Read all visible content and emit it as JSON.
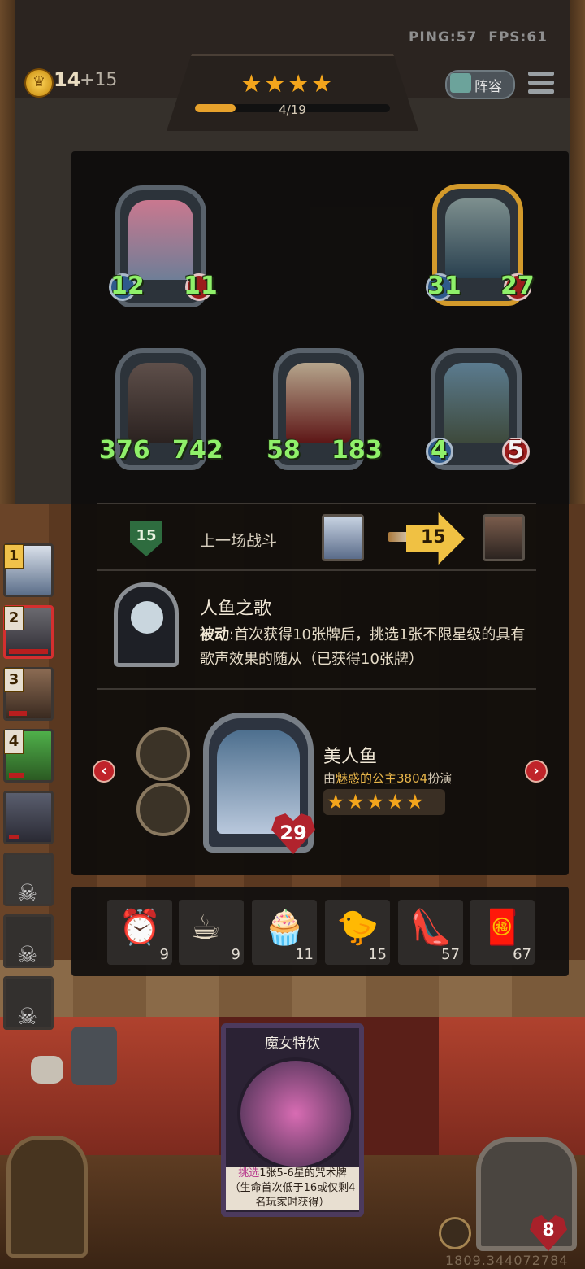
{
  "hud": {
    "ping": "PING:57",
    "fps": "FPS:61",
    "coins": "14",
    "coins_plus": "+15",
    "stars": "★★★★",
    "progress": "4/19",
    "progress_fraction": 0.21,
    "lineup_label": "阵容"
  },
  "board": {
    "top_row": [
      {
        "attack": "12",
        "health": "11",
        "frame": "silver"
      },
      {
        "attack": "",
        "health": "",
        "frame": "empty"
      },
      {
        "attack": "31",
        "health": "27",
        "frame": "gold"
      }
    ],
    "bottom_row": [
      {
        "attack": "376",
        "health": "742"
      },
      {
        "attack": "58",
        "health": "183"
      },
      {
        "attack": "4",
        "health": "5"
      }
    ]
  },
  "last_battle": {
    "shield_value": "15",
    "label": "上一场战斗",
    "damage": "15"
  },
  "skill": {
    "title": "人鱼之歌",
    "passive_label": "被动",
    "description": ":首次获得10张牌后，挑选1张不限星级的具有歌声效果的随从（已获得10张牌）"
  },
  "hero": {
    "name": "美人鱼",
    "sub_prefix": "由",
    "player_name": "魅惑的公主3804",
    "sub_suffix": "扮演",
    "stars": "★★★★★",
    "health": "29",
    "prev_arrow": "‹",
    "next_arrow": "›"
  },
  "items": [
    {
      "icon": "alarm-clock-icon",
      "glyph": "⏰",
      "count": "9"
    },
    {
      "icon": "teacup-icon",
      "glyph": "☕",
      "count": "9"
    },
    {
      "icon": "cupcake-icon",
      "glyph": "🧁",
      "count": "11"
    },
    {
      "icon": "rubber-chicken-icon",
      "glyph": "🐤",
      "count": "15"
    },
    {
      "icon": "glass-slipper-icon",
      "glyph": "👠",
      "count": "57"
    },
    {
      "icon": "lucky-bag-icon",
      "glyph": "🧧",
      "count": "67"
    }
  ],
  "roster": [
    {
      "rank": "1"
    },
    {
      "rank": "2"
    },
    {
      "rank": "3"
    },
    {
      "rank": "4"
    },
    {
      "rank": ""
    },
    {
      "rank": ""
    },
    {
      "rank": ""
    },
    {
      "rank": ""
    }
  ],
  "spell_card": {
    "title": "魔女特饮",
    "desc_highlight": "挑选",
    "desc_main": "1张5-6星的咒术牌",
    "desc_cond": "（生命首次低于16或仅剩4名玩家时获得）"
  },
  "player": {
    "health": "8",
    "coords": "1809.344072784"
  },
  "colors": {
    "gold": "#f3a51c",
    "attack_green": "#8ff06a",
    "danger_red": "#c0242a"
  }
}
